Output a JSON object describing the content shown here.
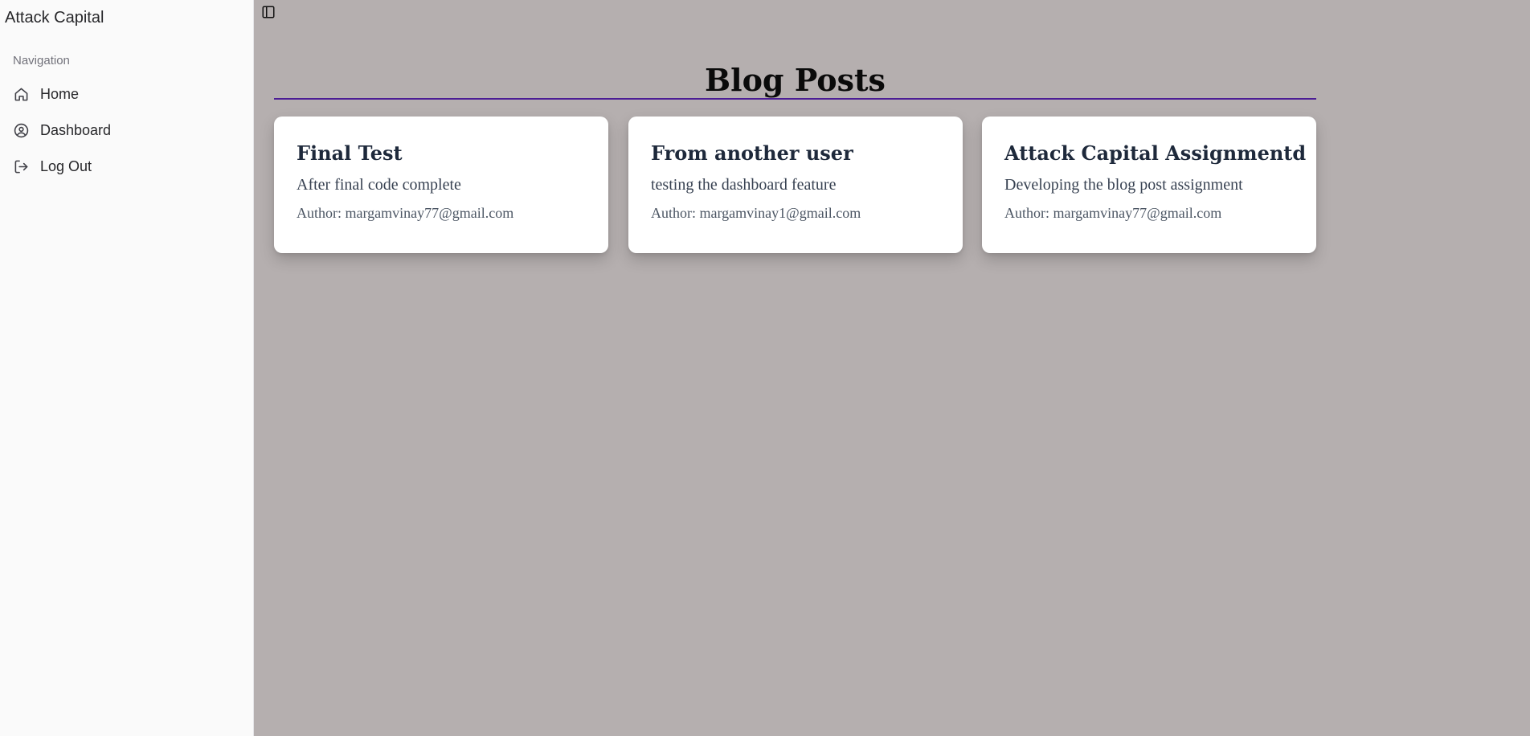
{
  "sidebar": {
    "app_title": "Attack Capital",
    "nav_heading": "Navigation",
    "items": [
      {
        "label": "Home",
        "icon": "home-icon"
      },
      {
        "label": "Dashboard",
        "icon": "user-circle-icon"
      },
      {
        "label": "Log Out",
        "icon": "logout-icon"
      }
    ]
  },
  "header": {
    "toggle_icon": "sidebar-toggle-icon"
  },
  "main": {
    "title": "Blog Posts",
    "accent_color": "#4c1d95",
    "posts": [
      {
        "title": "Final Test",
        "description": "After final code complete",
        "author": "Author: margamvinay77@gmail.com"
      },
      {
        "title": "From another user",
        "description": "testing the dashboard feature",
        "author": "Author: margamvinay1@gmail.com"
      },
      {
        "title": "Attack Capital Assignmentd",
        "description": "Developing the blog post assignment",
        "author": "Author: margamvinay77@gmail.com"
      }
    ]
  },
  "colors": {
    "sidebar_bg": "#fafafa",
    "main_bg": "#b5afaf",
    "card_bg": "#ffffff"
  }
}
